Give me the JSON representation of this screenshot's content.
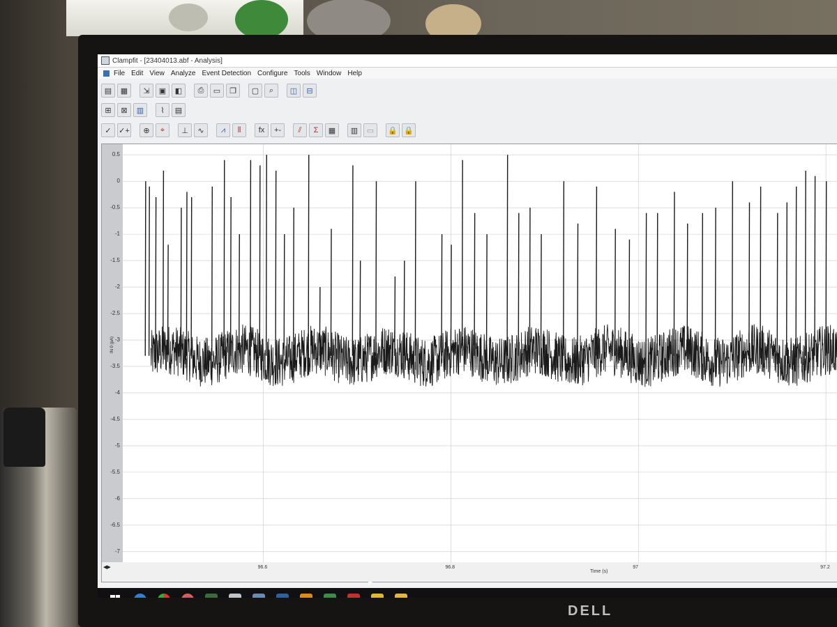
{
  "window": {
    "title": "Clampfit - [23404013.abf - Analysis]"
  },
  "menu": [
    "File",
    "Edit",
    "View",
    "Analyze",
    "Event Detection",
    "Configure",
    "Tools",
    "Window",
    "Help"
  ],
  "toolbar": {
    "row1": [
      "open-data-icon",
      "open-analysis-icon",
      "import-icon",
      "save-icon",
      "save-as-icon",
      "print-icon",
      "print-preview-icon",
      "copy-icon",
      "zoom-icon",
      "window-tile-vertical-icon",
      "window-tile-horizontal-icon"
    ],
    "row2": [
      "select-icon",
      "deselect-icon",
      "properties-icon",
      "trace-icon",
      "report-icon"
    ],
    "row3": [
      "accept-icon",
      "accept-next-icon",
      "zoom-in-icon",
      "cursor-icon",
      "baseline-icon",
      "fit-icon",
      "statistics-icon",
      "histogram-icon",
      "function-icon",
      "arithmetic-icon",
      "event-icon",
      "sum-icon",
      "results-icon",
      "level-icon",
      "lock-icon",
      "lock-all-icon"
    ],
    "row3_text": {
      "function": "fx",
      "arithmetic": "+-",
      "accept": "✓",
      "accept_next": "✓+"
    }
  },
  "chart_data": {
    "type": "line",
    "ylabel": "IN 0 (pA)",
    "xlabel": "Time (s)",
    "y_ticks": [
      "0.5",
      "0",
      "-0.5",
      "-1",
      "-1.5",
      "-2",
      "-2.5",
      "-3",
      "-3.5",
      "-4",
      "-4.5",
      "-5",
      "-5.5",
      "-6",
      "-6.5",
      "-7"
    ],
    "x_ticks": [
      "96.6",
      "96.8",
      "97",
      "97.2"
    ],
    "ylim": [
      -7.2,
      0.7
    ],
    "xlim": [
      96.45,
      97.22
    ],
    "baseline_pA": -3.3,
    "noise_pA": 0.3,
    "grid": true,
    "spikes": [
      {
        "x": 96.474,
        "y": 0.0
      },
      {
        "x": 96.478,
        "y": -0.1
      },
      {
        "x": 96.485,
        "y": -0.3
      },
      {
        "x": 96.493,
        "y": 0.2
      },
      {
        "x": 96.498,
        "y": -1.2
      },
      {
        "x": 96.512,
        "y": -0.5
      },
      {
        "x": 96.518,
        "y": -0.2
      },
      {
        "x": 96.523,
        "y": -0.3
      },
      {
        "x": 96.545,
        "y": -0.1
      },
      {
        "x": 96.558,
        "y": 0.4
      },
      {
        "x": 96.565,
        "y": -0.3
      },
      {
        "x": 96.574,
        "y": -1.0
      },
      {
        "x": 96.586,
        "y": 0.4
      },
      {
        "x": 96.596,
        "y": 0.3
      },
      {
        "x": 96.603,
        "y": 0.5
      },
      {
        "x": 96.613,
        "y": 0.2
      },
      {
        "x": 96.622,
        "y": -1.0
      },
      {
        "x": 96.632,
        "y": -0.5
      },
      {
        "x": 96.648,
        "y": 0.5
      },
      {
        "x": 96.66,
        "y": -2.0
      },
      {
        "x": 96.672,
        "y": -0.9
      },
      {
        "x": 96.695,
        "y": 0.3
      },
      {
        "x": 96.703,
        "y": -1.5
      },
      {
        "x": 96.72,
        "y": 0.0
      },
      {
        "x": 96.74,
        "y": -1.8
      },
      {
        "x": 96.75,
        "y": -1.5
      },
      {
        "x": 96.762,
        "y": 0.0
      },
      {
        "x": 96.79,
        "y": -1.0
      },
      {
        "x": 96.8,
        "y": -1.2
      },
      {
        "x": 96.812,
        "y": 0.4
      },
      {
        "x": 96.825,
        "y": -0.6
      },
      {
        "x": 96.838,
        "y": -1.0
      },
      {
        "x": 96.86,
        "y": 0.5
      },
      {
        "x": 96.872,
        "y": -0.6
      },
      {
        "x": 96.884,
        "y": -0.5
      },
      {
        "x": 96.896,
        "y": -1.0
      },
      {
        "x": 96.92,
        "y": 0.0
      },
      {
        "x": 96.935,
        "y": -0.8
      },
      {
        "x": 96.955,
        "y": -0.1
      },
      {
        "x": 96.975,
        "y": -0.9
      },
      {
        "x": 96.99,
        "y": -1.1
      },
      {
        "x": 97.008,
        "y": -0.6
      },
      {
        "x": 97.02,
        "y": -0.6
      },
      {
        "x": 97.038,
        "y": -0.2
      },
      {
        "x": 97.052,
        "y": -0.8
      },
      {
        "x": 97.068,
        "y": -0.6
      },
      {
        "x": 97.082,
        "y": -0.5
      },
      {
        "x": 97.1,
        "y": 0.0
      },
      {
        "x": 97.118,
        "y": -0.4
      },
      {
        "x": 97.13,
        "y": -0.1
      },
      {
        "x": 97.148,
        "y": -0.6
      },
      {
        "x": 97.158,
        "y": -0.4
      },
      {
        "x": 97.168,
        "y": -0.1
      },
      {
        "x": 97.178,
        "y": 0.2
      },
      {
        "x": 97.188,
        "y": 0.1
      },
      {
        "x": 97.2,
        "y": 0.0
      }
    ]
  },
  "photo": {
    "monitor_brand": "DELL"
  },
  "taskbar": {
    "icons": [
      "start-icon",
      "edge-icon",
      "chrome-icon",
      "firefox-icon",
      "media-icon",
      "clampfit-icon",
      "explorer-icon",
      "app-icon",
      "visio-icon",
      "excel-icon",
      "word-icon",
      "files-icon",
      "folder-icon"
    ]
  },
  "colors": {
    "trace": "#1a1a1a",
    "grid": "#c8c8c8",
    "taskbar": "#101012",
    "accent": "#3a6fb0"
  }
}
